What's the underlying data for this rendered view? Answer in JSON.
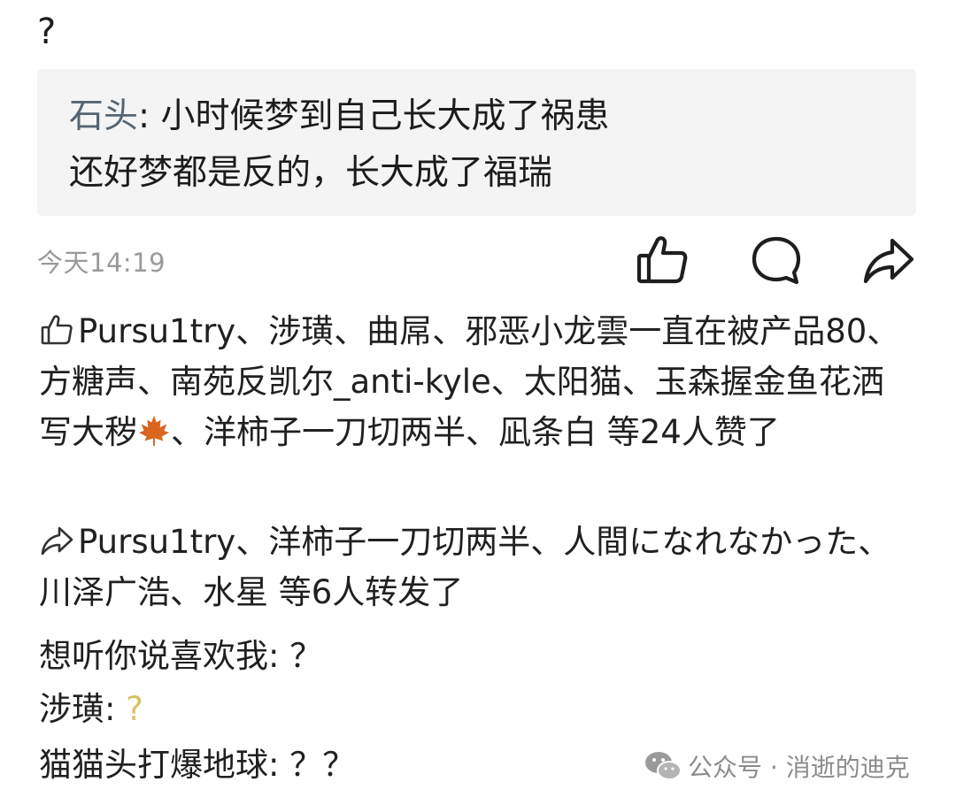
{
  "post": {
    "text": "?"
  },
  "quote": {
    "author": "石头",
    "line1_after_author": ": 小时候梦到自己长大成了祸患",
    "line2": "还好梦都是反的，长大成了福瑞"
  },
  "meta": {
    "timestamp": "今天14:19",
    "icons": [
      "thumbs-up-icon",
      "comment-icon",
      "share-icon"
    ]
  },
  "likes": {
    "text_before_emoji": "Pursu1try、涉璜、曲屌、邪恶小龙雲一直在被产品80、方糖声、南苑反凯尔_anti-kyle、太阳猫、玉森握金鱼花洒写大秽",
    "emoji": "maple-leaf-icon",
    "text_after_emoji": "、洋柿子一刀切两半、凪条白 等24人赞了"
  },
  "shares": {
    "text": "Pursu1try、洋柿子一刀切两半、人間になれなかった、川泽广浩、水星 等6人转发了"
  },
  "comments": [
    {
      "author": "想听你说喜欢我",
      "sep": ":",
      "body": " ？",
      "style": "normal"
    },
    {
      "author": "涉璜",
      "sep": ":",
      "body": " ?",
      "style": "yellow"
    },
    {
      "author": "猫猫头打爆地球",
      "sep": ":",
      "body": " ？？",
      "style": "normal"
    }
  ],
  "watermark": {
    "text": "公众号 · 消逝的迪克",
    "icon": "wechat-icon"
  }
}
